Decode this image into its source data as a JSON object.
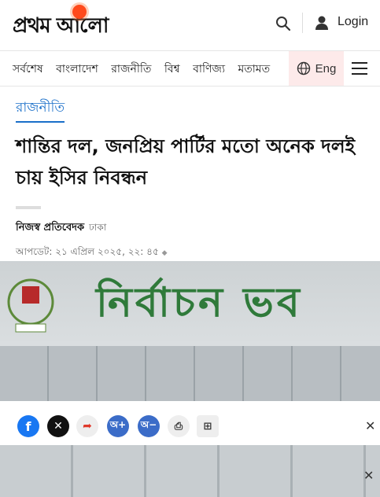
{
  "header": {
    "logo_text": "প্রথম আলো",
    "login_label": "Login"
  },
  "nav": {
    "items": [
      "সর্বশেষ",
      "বাংলাদেশ",
      "রাজনীতি",
      "বিশ্ব",
      "বাণিজ্য",
      "মতামত"
    ],
    "lang_label": "Eng"
  },
  "article": {
    "section": "রাজনীতি",
    "headline": "শান্তির দল, জনপ্রিয় পার্টির মতো অনেক দলই চায় ইসির নিবন্ধন",
    "author": "নিজস্ব প্রতিবেদক",
    "location": "ঢাকা",
    "updated": "আপডেট: ২১ এপ্রিল ২০২৫, ২২: ৪৫",
    "photo_sign_text": "নির্বাচন ভব"
  },
  "share": {
    "font_increase": "অ+",
    "font_decrease": "অ−"
  },
  "colors": {
    "accent": "#1a6fc9",
    "logo_sun": "#ff4a1c",
    "lang_bg": "#fdeaea",
    "facebook": "#1877f2",
    "share_red": "#e0392b",
    "font_btn": "#3b6cc8",
    "sign_green": "#2f7a3a"
  }
}
